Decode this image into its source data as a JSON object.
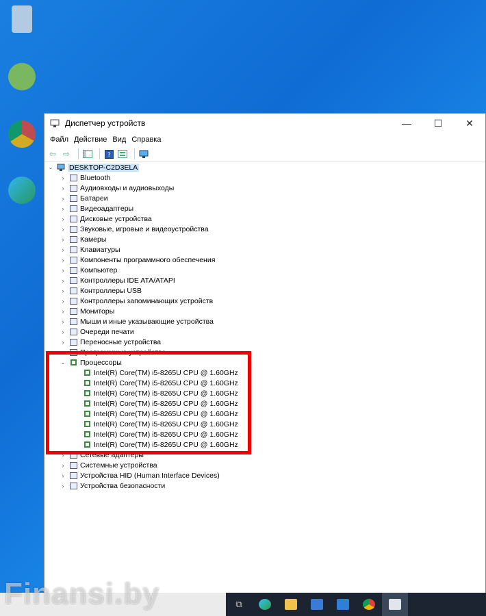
{
  "window": {
    "title": "Диспетчер устройств",
    "controls": {
      "minimize": "—",
      "maximize": "☐",
      "close": "✕"
    }
  },
  "menu": [
    "Файл",
    "Действие",
    "Вид",
    "Справка"
  ],
  "tree": {
    "root": "DESKTOP-C2D3ELA",
    "categories_before": [
      {
        "label": "Bluetooth",
        "icon": "bluetooth-icon"
      },
      {
        "label": "Аудиовходы и аудиовыходы",
        "icon": "speaker-icon"
      },
      {
        "label": "Батареи",
        "icon": "battery-icon"
      },
      {
        "label": "Видеоадаптеры",
        "icon": "display-adapter-icon"
      },
      {
        "label": "Дисковые устройства",
        "icon": "disk-drive-icon"
      },
      {
        "label": "Звуковые, игровые и видеоустройства",
        "icon": "sound-icon"
      },
      {
        "label": "Камеры",
        "icon": "camera-icon"
      },
      {
        "label": "Клавиатуры",
        "icon": "keyboard-icon"
      },
      {
        "label": "Компоненты программного обеспечения",
        "icon": "software-component-icon"
      },
      {
        "label": "Компьютер",
        "icon": "computer-icon"
      },
      {
        "label": "Контроллеры IDE ATA/ATAPI",
        "icon": "ide-controller-icon"
      },
      {
        "label": "Контроллеры USB",
        "icon": "usb-icon"
      },
      {
        "label": "Контроллеры запоминающих устройств",
        "icon": "storage-controller-icon"
      },
      {
        "label": "Мониторы",
        "icon": "monitor-icon"
      },
      {
        "label": "Мыши и иные указывающие устройства",
        "icon": "mouse-icon"
      },
      {
        "label": "Очереди печати",
        "icon": "printer-icon"
      },
      {
        "label": "Переносные устройства",
        "icon": "portable-device-icon"
      },
      {
        "label": "Программные устройства",
        "icon": "software-device-icon"
      }
    ],
    "expanded_category": "Процессоры",
    "processors": [
      "Intel(R) Core(TM) i5-8265U CPU @ 1.60GHz",
      "Intel(R) Core(TM) i5-8265U CPU @ 1.60GHz",
      "Intel(R) Core(TM) i5-8265U CPU @ 1.60GHz",
      "Intel(R) Core(TM) i5-8265U CPU @ 1.60GHz",
      "Intel(R) Core(TM) i5-8265U CPU @ 1.60GHz",
      "Intel(R) Core(TM) i5-8265U CPU @ 1.60GHz",
      "Intel(R) Core(TM) i5-8265U CPU @ 1.60GHz",
      "Intel(R) Core(TM) i5-8265U CPU @ 1.60GHz"
    ],
    "categories_after": [
      {
        "label": "Сетевые адаптеры",
        "icon": "network-adapter-icon"
      },
      {
        "label": "Системные устройства",
        "icon": "system-device-icon"
      },
      {
        "label": "Устройства HID (Human Interface Devices)",
        "icon": "hid-icon"
      },
      {
        "label": "Устройства безопасности",
        "icon": "security-device-icon"
      }
    ]
  },
  "watermark": "Finansi.by",
  "colors": {
    "highlight": "#ef0000",
    "selection": "#cce4f7",
    "desktop": "#0f6cd4"
  }
}
